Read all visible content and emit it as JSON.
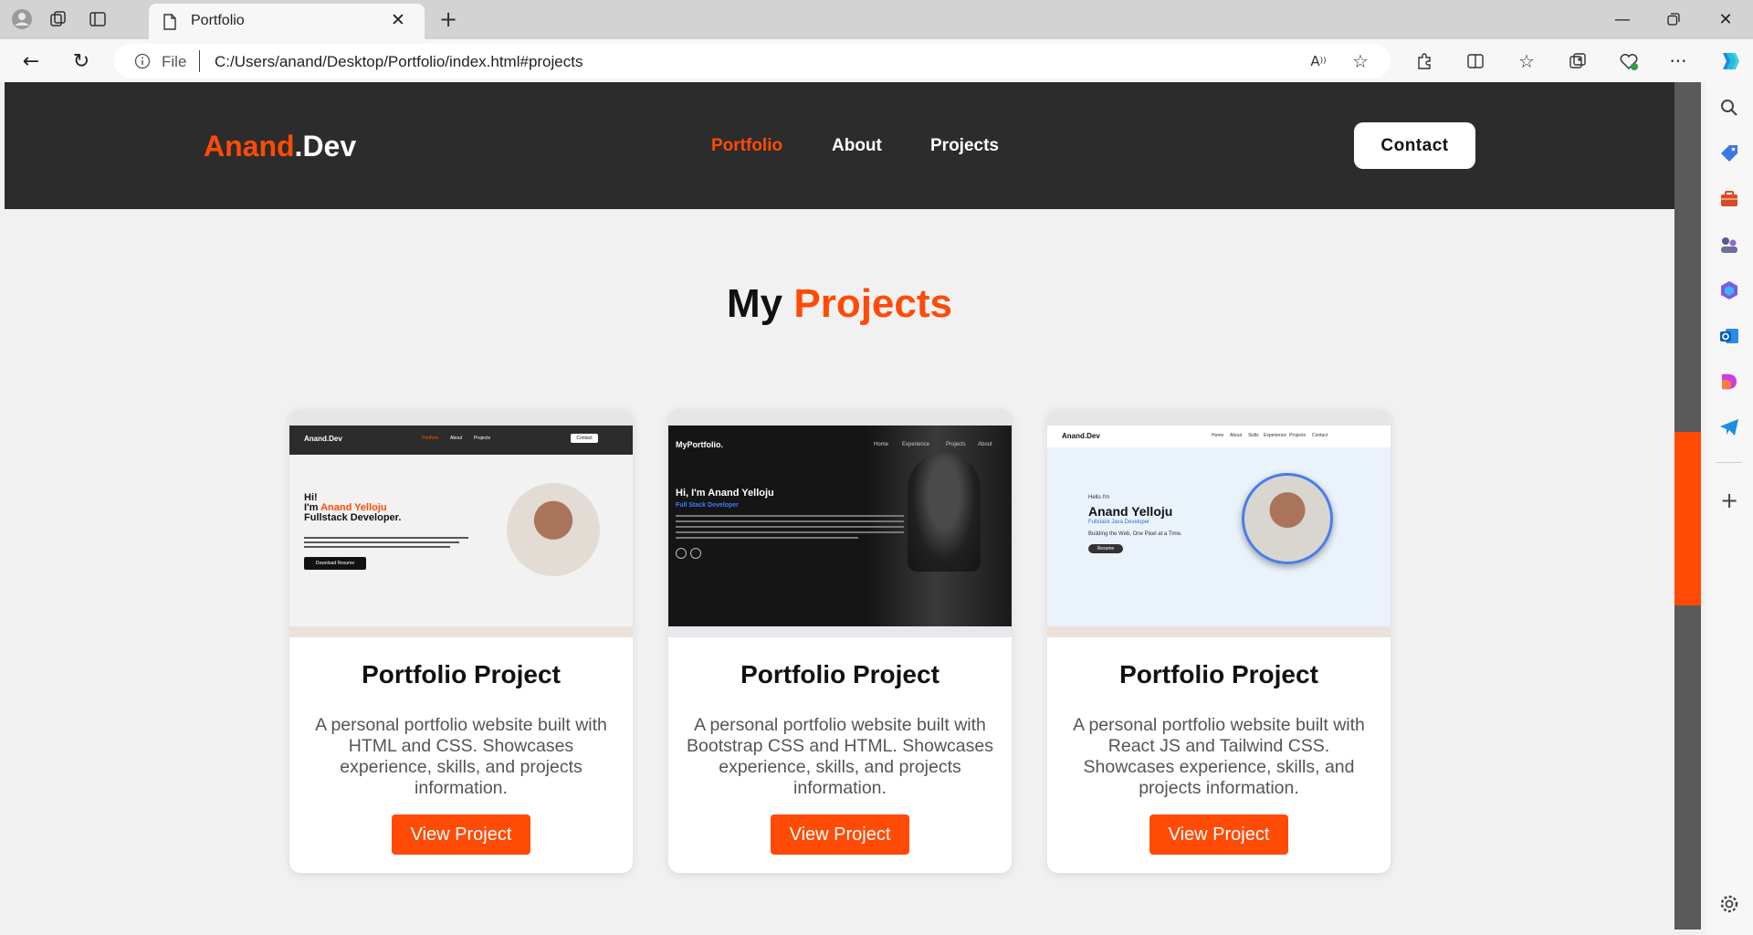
{
  "browser": {
    "tab_title": "Portfolio",
    "url_scheme_label": "File",
    "url": "C:/Users/anand/Desktop/Portfolio/index.html#projects"
  },
  "site": {
    "logo_first": "Anand",
    "logo_second": ".Dev",
    "nav": [
      "Portfolio",
      "About",
      "Projects"
    ],
    "contact_label": "Contact"
  },
  "projects_section": {
    "title_first": "My",
    "title_second": "Projects",
    "cards": [
      {
        "title": "Portfolio Project",
        "description": "A personal portfolio website built with HTML and CSS. Showcases experience, skills, and projects information.",
        "button": "View Project",
        "shot": {
          "logo": "Anand.Dev",
          "nav": [
            "Portfolio",
            "About",
            "Projects"
          ],
          "contact": "Contact",
          "greeting": "Hi!",
          "im": "I'm",
          "name": "Anand Yelloju",
          "role": "Fullstack Developer.",
          "button": "Download Resume"
        }
      },
      {
        "title": "Portfolio Project",
        "description": "A personal portfolio website built with Bootstrap CSS and HTML. Showcases experience, skills, and projects information.",
        "button": "View Project",
        "shot": {
          "logo": "MyPortfolio.",
          "nav": [
            "Home",
            "Experience",
            "Projects",
            "About"
          ],
          "heading": "Hi, I'm Anand Yelloju",
          "role": "Full Stack Developer"
        }
      },
      {
        "title": "Portfolio Project",
        "description": "A personal portfolio website built with React JS and Tailwind CSS. Showcases experience, skills, and projects information.",
        "button": "View Project",
        "shot": {
          "logo": "Anand.Dev",
          "nav": [
            "Home",
            "About",
            "Skills",
            "Experience",
            "Projects",
            "Contact"
          ],
          "hello": "Hello I'm",
          "name": "Anand Yelloju",
          "role": "Fullstack Java Developer",
          "tagline": "Building the Web, One Pixel at a Time.",
          "button": "Resume"
        }
      }
    ]
  },
  "colors": {
    "accent": "#ff4b06",
    "nav_bg": "#2c2c2c",
    "page_bg": "#f1f1f1",
    "card_bg": "#ffffff"
  },
  "icons": [
    "profile-icon",
    "workspaces-icon",
    "tab-actions-icon",
    "page-icon",
    "close-icon",
    "new-tab-icon",
    "minimize-icon",
    "restore-icon",
    "back-icon",
    "refresh-icon",
    "info-icon",
    "read-aloud-icon",
    "favorite-star-icon",
    "extensions-icon",
    "split-screen-icon",
    "favorites-icon",
    "collections-icon",
    "browser-essentials-icon",
    "more-icon",
    "copilot-icon",
    "search-icon",
    "shopping-icon",
    "tools-icon",
    "games-icon",
    "m365-icon",
    "outlook-icon",
    "designer-icon",
    "telegram-icon",
    "add-icon",
    "settings-icon"
  ]
}
